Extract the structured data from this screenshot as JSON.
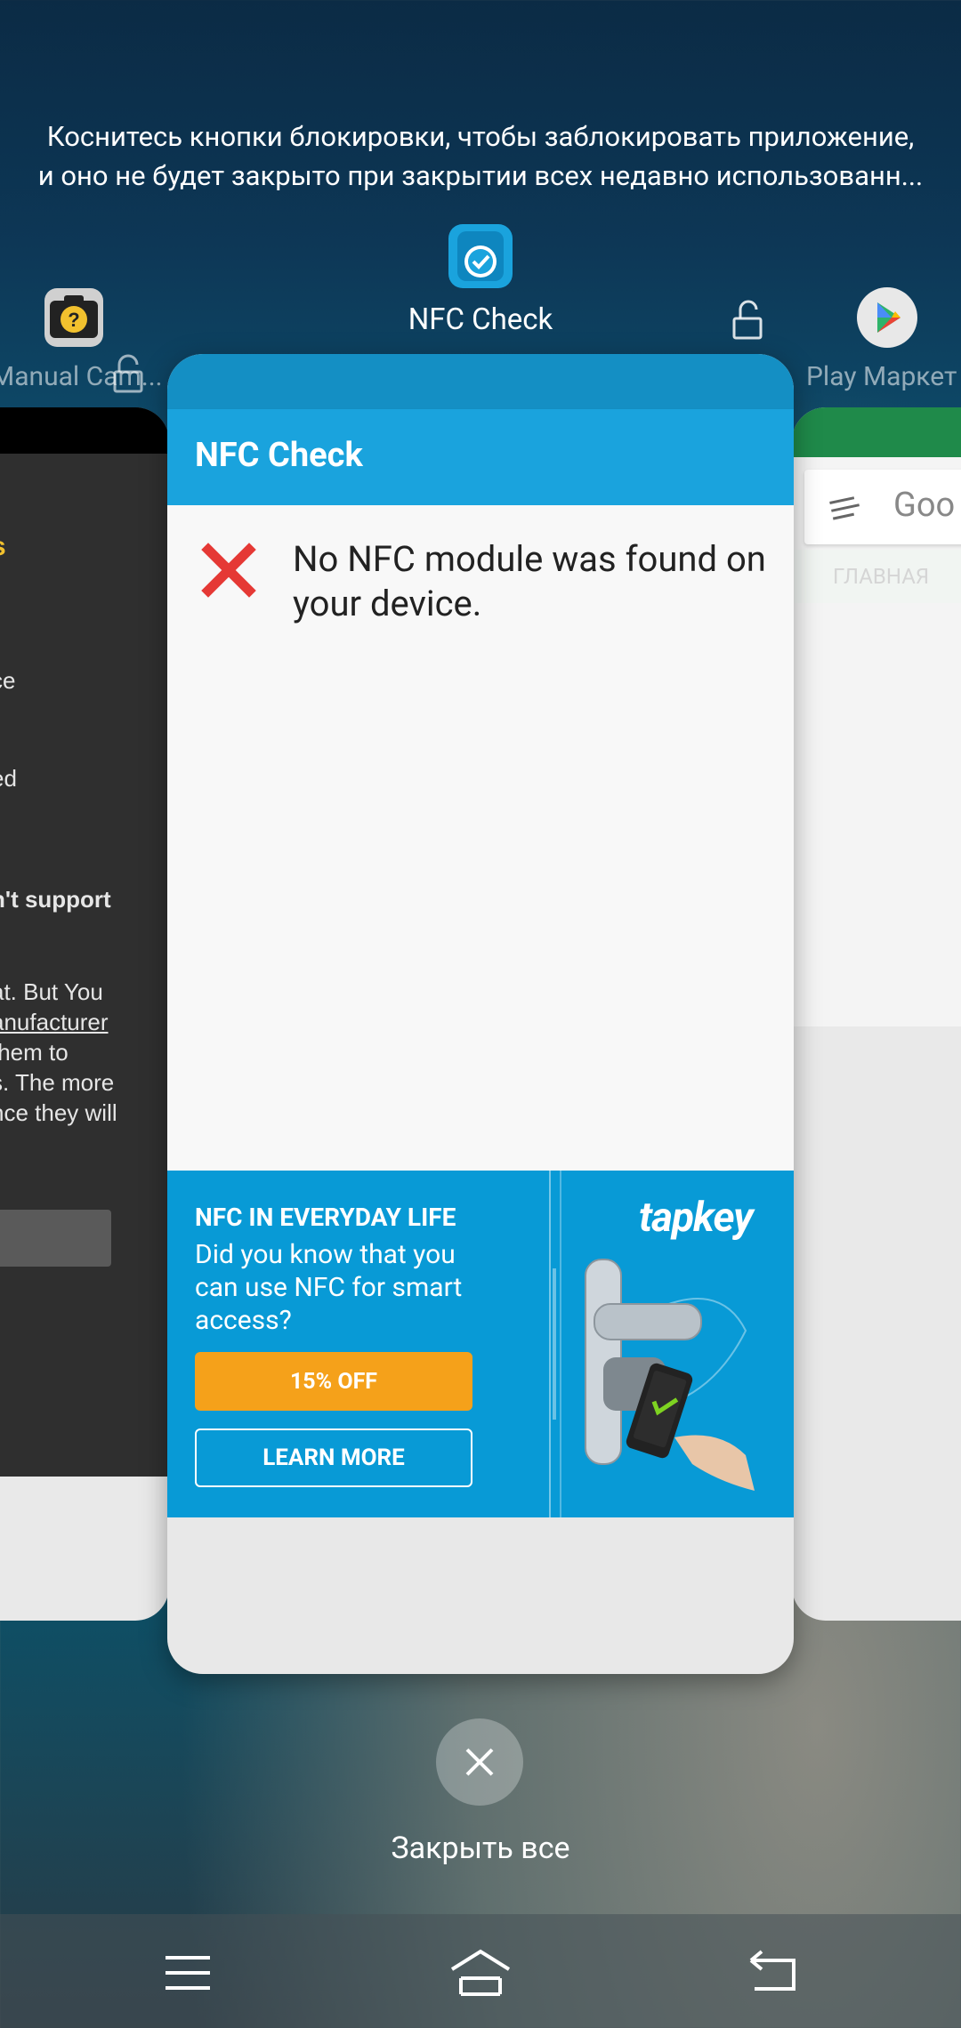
{
  "hint": {
    "line1": "Коснитесь кнопки блокировки, чтобы заблокировать приложение,",
    "line2": "и оно не будет закрыто при закрытии всех недавно использованн..."
  },
  "apps": {
    "left": {
      "label": "Manual Cam...",
      "icon": "manual-camera-icon"
    },
    "center": {
      "label": "NFC Check",
      "icon": "nfc-check-icon"
    },
    "right": {
      "label": "Play Маркет",
      "icon": "play-store-icon"
    }
  },
  "left_card": {
    "texts": [
      "s",
      "ce",
      "ed",
      "n't support",
      "at. But You",
      "anufacturer",
      " them to",
      "s. The more",
      "nce they will"
    ]
  },
  "right_card": {
    "search_placeholder": "Goo",
    "tab": "ГЛАВНАЯ"
  },
  "nfc_app": {
    "title": "NFC Check",
    "message": "No NFC module was found on your device.",
    "ad": {
      "heading": "NFC IN EVERYDAY LIFE",
      "text": "Did you know that you can use NFC for smart access?",
      "offer_button": "15% OFF",
      "learn_button": "LEARN MORE",
      "brand": "tapkey"
    }
  },
  "close_all": {
    "label": "Закрыть все"
  },
  "colors": {
    "accent": "#1aa3dd",
    "error": "#e53935",
    "offer": "#f5a11a"
  }
}
